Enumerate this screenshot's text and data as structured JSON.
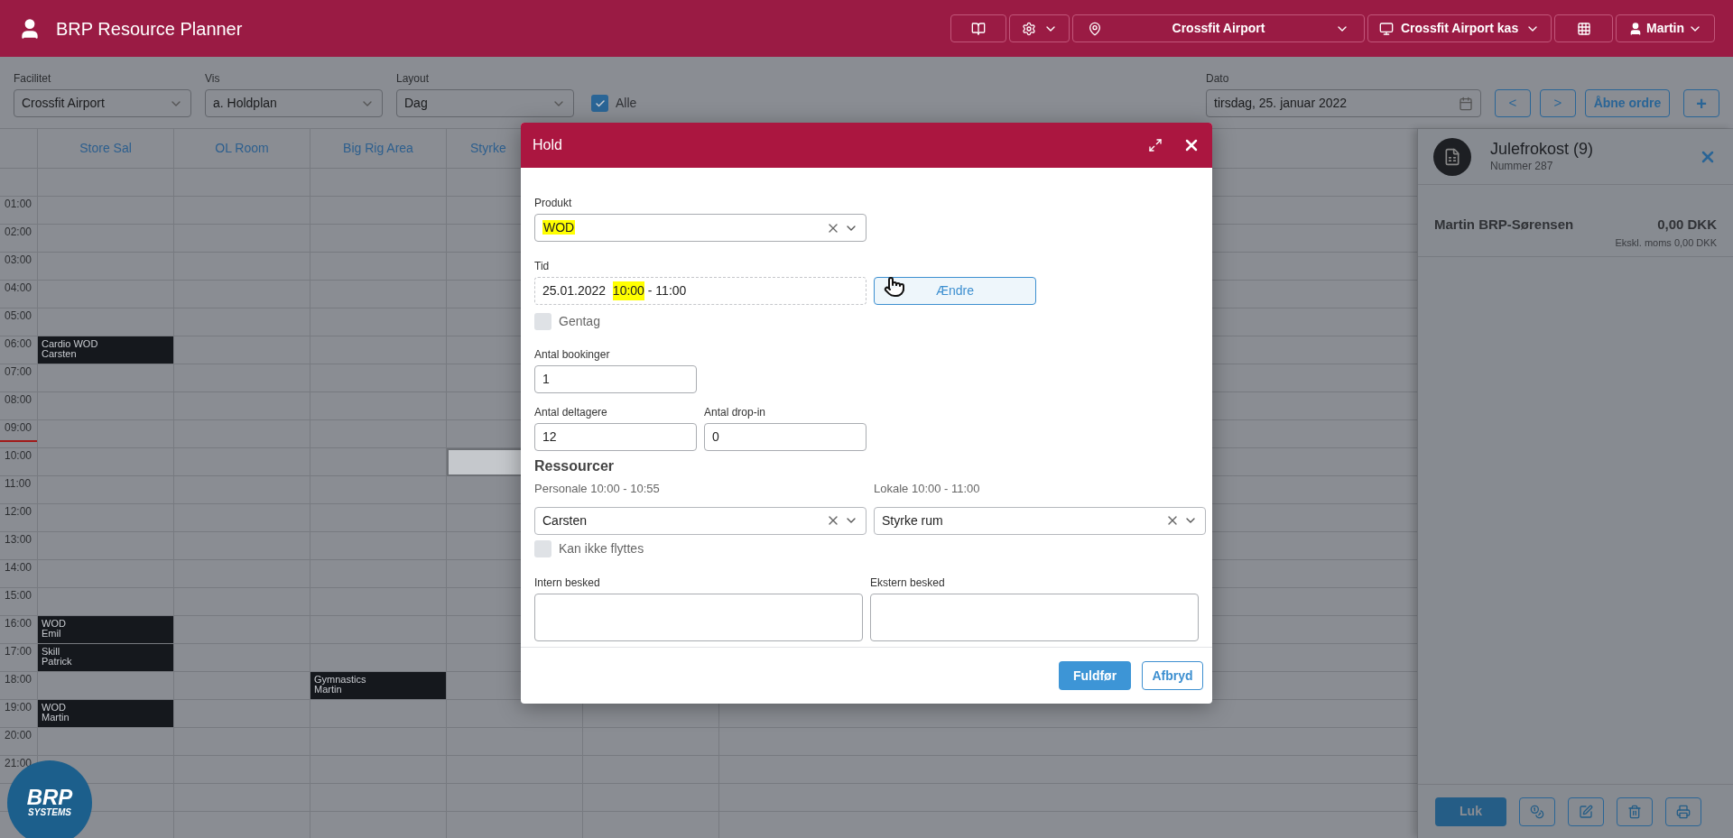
{
  "app": {
    "title": "BRP Resource Planner"
  },
  "top_bar": {
    "location": "Crossfit Airport",
    "register": "Crossfit Airport kas",
    "user": "Martin"
  },
  "filters": [
    {
      "label": "Facilitet",
      "value": "Crossfit Airport"
    },
    {
      "label": "Vis",
      "value": "a. Holdplan"
    },
    {
      "label": "Layout",
      "value": "Dag"
    }
  ],
  "alle": {
    "label": "Alle",
    "checked": true
  },
  "date": {
    "label": "Dato",
    "value": "tirsdag, 25. januar 2022"
  },
  "date_buttons": {
    "prev": "<",
    "next": ">",
    "open_orders": "Åbne ordre",
    "add": "+"
  },
  "calendar": {
    "columns": [
      "Store Sal",
      "OL Room",
      "Big Rig Area",
      "Styrke"
    ],
    "rows": [
      {
        "time": "01:00"
      },
      {
        "time": "02:00"
      },
      {
        "time": "03:00"
      },
      {
        "time": "04:00"
      },
      {
        "time": "05:00"
      },
      {
        "time": "06:00",
        "cells": [
          {
            "kind": "event",
            "title": "Cardio WOD",
            "person": "Carsten"
          }
        ]
      },
      {
        "time": "07:00"
      },
      {
        "time": "08:00"
      },
      {
        "time": "09:00",
        "now_marker": true
      },
      {
        "time": "10:00",
        "cells": [
          {
            "kind": "empty"
          },
          {
            "kind": "empty"
          },
          {
            "kind": "empty"
          },
          {
            "kind": "selected"
          }
        ]
      },
      {
        "time": "11:00"
      },
      {
        "time": "12:00"
      },
      {
        "time": "13:00"
      },
      {
        "time": "14:00"
      },
      {
        "time": "15:00"
      },
      {
        "time": "16:00",
        "cells": [
          {
            "kind": "event",
            "title": "WOD",
            "person": "Emil"
          }
        ]
      },
      {
        "time": "17:00",
        "cells": [
          {
            "kind": "event",
            "title": "Skill",
            "person": "Patrick"
          }
        ]
      },
      {
        "time": "18:00",
        "cells": [
          {
            "kind": "empty"
          },
          {
            "kind": "empty"
          },
          {
            "kind": "event",
            "title": "Gymnastics",
            "person": "Martin"
          }
        ]
      },
      {
        "time": "19:00",
        "cells": [
          {
            "kind": "event",
            "title": "WOD",
            "person": "Martin"
          }
        ]
      },
      {
        "time": "20:00"
      },
      {
        "time": "21:00"
      }
    ]
  },
  "logo": {
    "name": "BRP",
    "tagline": "SYSTEMS"
  },
  "order_panel": {
    "title": "Julefrokost (9)",
    "number": "Nummer 287",
    "lines": [
      {
        "name": "Martin BRP-Sørensen",
        "amount": "0,00 DKK",
        "excl": "Ekskl. moms 0,00 DKK"
      }
    ],
    "close_button": "Luk"
  },
  "dialog": {
    "title": "Hold",
    "product": {
      "label": "Produkt",
      "value": "WOD",
      "highlighted": true
    },
    "time": {
      "label": "Tid",
      "date": "25.01.2022",
      "start": "10:00",
      "start_highlighted": true,
      "end": "- 11:00",
      "button": "Ændre"
    },
    "repeat": {
      "label": "Gentag",
      "checked": false
    },
    "bookings": {
      "label": "Antal bookinger",
      "value": "1"
    },
    "participants": {
      "label": "Antal deltagere",
      "value": "12"
    },
    "dropin": {
      "label": "Antal drop-in",
      "value": "0"
    },
    "resources_heading": "Ressourcer",
    "staff": {
      "label": "Personale 10:00 - 10:55",
      "value": "Carsten"
    },
    "room": {
      "label": "Lokale 10:00 - 11:00",
      "value": "Styrke rum"
    },
    "locked": {
      "label": "Kan ikke flyttes",
      "checked": false
    },
    "internal": {
      "label": "Intern besked"
    },
    "external": {
      "label": "Ekstern besked"
    },
    "buttons": {
      "primary": "Fuldfør",
      "cancel": "Afbryd"
    }
  }
}
